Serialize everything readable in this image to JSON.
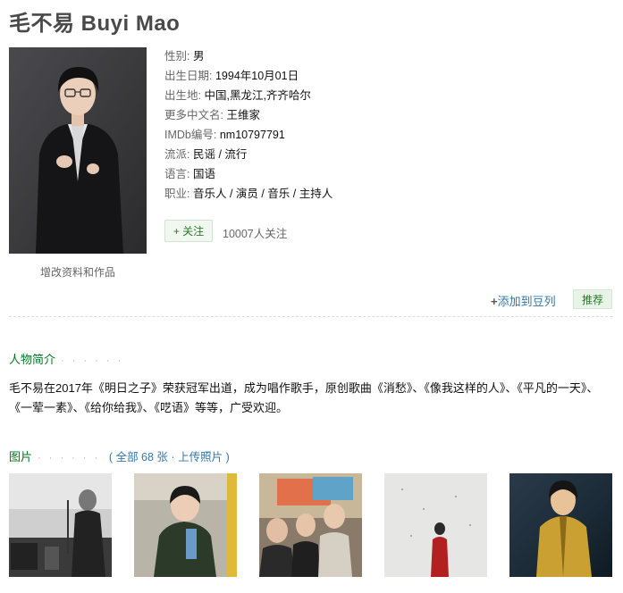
{
  "page": {
    "name": "毛不易 Buyi Mao",
    "edit_link": "增改资料和作品"
  },
  "profile": {
    "rows": [
      {
        "key": "性别:",
        "value": "男"
      },
      {
        "key": "出生日期:",
        "value": "1994年10月01日"
      },
      {
        "key": "出生地:",
        "value": "中国,黑龙江,齐齐哈尔"
      },
      {
        "key": "更多中文名:",
        "value": "王维家"
      },
      {
        "key": "IMDb编号:",
        "value": "nm10797791"
      },
      {
        "key": "流派:",
        "value": "民谣 / 流行"
      },
      {
        "key": "语言:",
        "value": "国语"
      },
      {
        "key": "职业:",
        "value": "音乐人 / 演员 / 音乐 / 主持人"
      }
    ],
    "follow_label": "+ 关注",
    "follow_count": "10007人关注"
  },
  "actions": {
    "add_doulist_plus": "+",
    "add_doulist": "添加到豆列",
    "recommend": "推荐"
  },
  "bio": {
    "title": "人物简介",
    "dots": "· · · · · ·",
    "text": "毛不易在2017年《明日之子》荣获冠军出道，成为唱作歌手，原创歌曲《消愁》、《像我这样的人》、《平凡的一天》、《一荤一素》、《给你给我》、《呓语》等等，广受欢迎。"
  },
  "photos": {
    "title": "图片",
    "dots": "· · · · · ·",
    "open_paren": "(",
    "all_label": "全部 68 张",
    "separator": "·",
    "upload_label": "上传照片",
    "close_paren": ")",
    "items": [
      {
        "alt": "photo-1"
      },
      {
        "alt": "photo-2"
      },
      {
        "alt": "photo-3"
      },
      {
        "alt": "photo-4"
      },
      {
        "alt": "photo-5"
      }
    ]
  },
  "colors": {
    "section_green": "#007722",
    "link_blue": "#3377aa",
    "title_gray": "#494949"
  }
}
